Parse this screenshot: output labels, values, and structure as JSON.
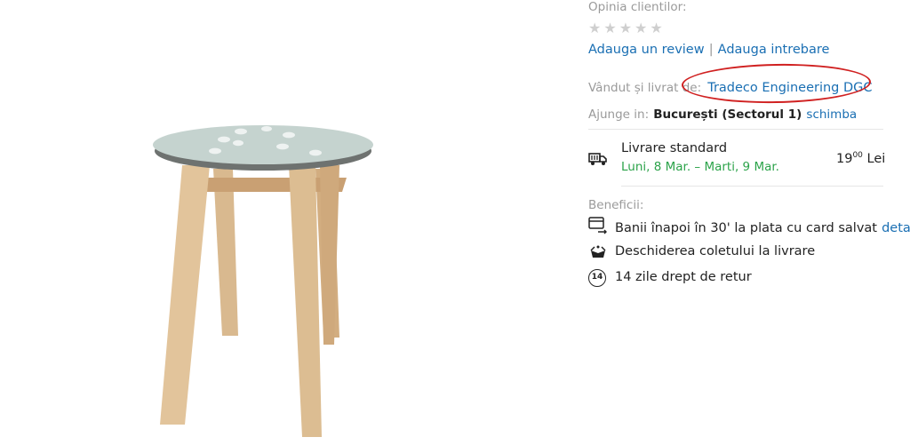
{
  "reviews": {
    "label": "Opinia clientilor:",
    "rating": 0,
    "max_rating": 5,
    "add_review": "Adauga un review",
    "separator": "|",
    "add_question": "Adauga intrebare"
  },
  "seller": {
    "label": "Vândut și livrat de:",
    "name": "Tradeco Engineering DGC"
  },
  "delivery_location": {
    "label": "Ajunge in:",
    "city": "București (Sectorul 1)",
    "change": "schimba"
  },
  "shipping": {
    "icon": "truck-icon",
    "title": "Livrare standard",
    "dates": "Luni, 8 Mar. – Marti, 9 Mar.",
    "price_int": "19",
    "price_dec": "00",
    "currency": "Lei"
  },
  "benefits": {
    "label": "Beneficii:",
    "items": [
      {
        "icon": "card-refund-icon",
        "text": "Banii înapoi în 30' la plata cu card salvat",
        "link": "detalii"
      },
      {
        "icon": "open-package-icon",
        "text": "Deschiderea coletului la livrare"
      },
      {
        "icon": "return-14-icon",
        "badge": "14",
        "text": "14 zile drept de retur"
      }
    ]
  },
  "colors": {
    "link": "#1a6fb3",
    "delivery_green": "#2ca34a",
    "annotation_red": "#d02020",
    "star_empty": "#cfcfcf"
  }
}
